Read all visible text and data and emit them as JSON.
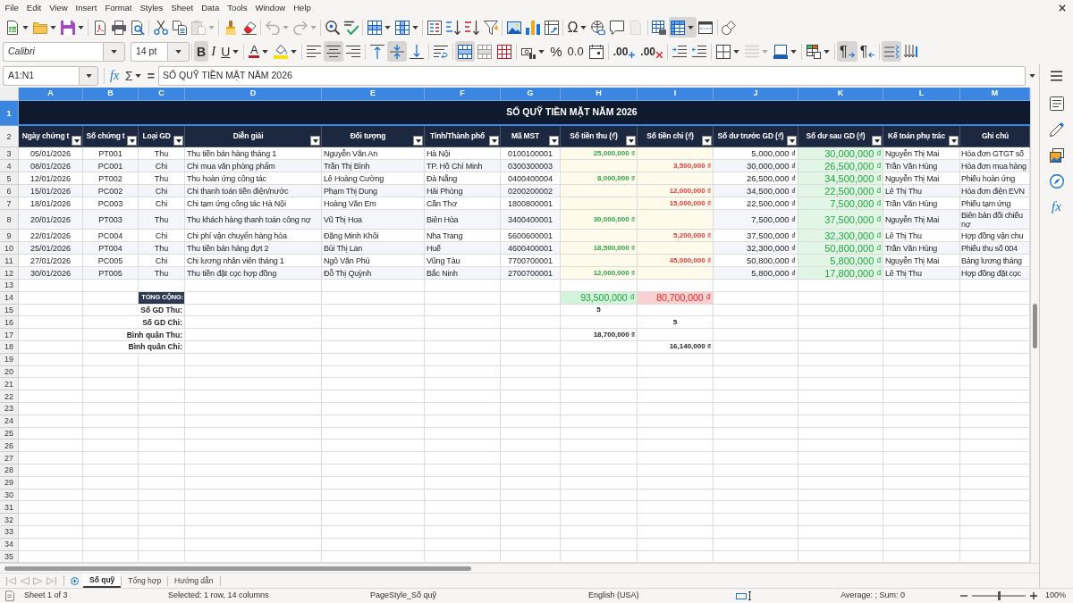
{
  "menu": [
    "File",
    "Edit",
    "View",
    "Insert",
    "Format",
    "Styles",
    "Sheet",
    "Data",
    "Tools",
    "Window",
    "Help"
  ],
  "standard_toolbar": [
    [
      {
        "kind": "new",
        "dropdown": true,
        "on": false,
        "disabled": false
      },
      {
        "kind": "open",
        "dropdown": true,
        "on": false,
        "disabled": false
      },
      {
        "kind": "save",
        "dropdown": true,
        "on": false,
        "disabled": false
      }
    ],
    [
      {
        "kind": "pdf",
        "dropdown": false,
        "on": false,
        "disabled": false
      },
      {
        "kind": "print",
        "dropdown": false,
        "on": false,
        "disabled": false
      },
      {
        "kind": "preview",
        "dropdown": false,
        "on": false,
        "disabled": false
      }
    ],
    [
      {
        "kind": "cut",
        "dropdown": false,
        "on": false,
        "disabled": false
      },
      {
        "kind": "copy",
        "dropdown": false,
        "on": false,
        "disabled": false
      },
      {
        "kind": "paste",
        "dropdown": true,
        "on": false,
        "disabled": true
      }
    ],
    [
      {
        "kind": "clone",
        "dropdown": false,
        "on": false,
        "disabled": false
      },
      {
        "kind": "clear",
        "dropdown": false,
        "on": false,
        "disabled": false
      }
    ],
    [
      {
        "kind": "undo",
        "dropdown": true,
        "on": false,
        "disabled": true
      },
      {
        "kind": "redo",
        "dropdown": true,
        "on": false,
        "disabled": true
      }
    ],
    [
      {
        "kind": "find",
        "dropdown": false,
        "on": false,
        "disabled": false
      },
      {
        "kind": "spelling",
        "dropdown": false,
        "on": false,
        "disabled": false
      }
    ],
    [
      {
        "kind": "rows",
        "dropdown": true,
        "on": false,
        "disabled": false
      },
      {
        "kind": "columns",
        "dropdown": true,
        "on": false,
        "disabled": false
      }
    ],
    [
      {
        "kind": "sort",
        "dropdown": false,
        "on": false,
        "disabled": false
      },
      {
        "kind": "sort_ascending",
        "dropdown": false,
        "on": false,
        "disabled": false
      },
      {
        "kind": "sort_descending",
        "dropdown": false,
        "on": false,
        "disabled": false
      },
      {
        "kind": "autofilter",
        "dropdown": false,
        "on": false,
        "disabled": false
      }
    ],
    [
      {
        "kind": "image",
        "dropdown": false,
        "on": false,
        "disabled": false
      },
      {
        "kind": "chart",
        "dropdown": false,
        "on": false,
        "disabled": false
      },
      {
        "kind": "pivot",
        "dropdown": false,
        "on": false,
        "disabled": false
      }
    ],
    [
      {
        "kind": "special_character",
        "glyph": "Ω",
        "dropdown": true,
        "on": false,
        "disabled": false
      },
      {
        "kind": "hyperlink",
        "dropdown": false,
        "on": false,
        "disabled": false
      },
      {
        "kind": "comment",
        "dropdown": false,
        "on": false,
        "disabled": false
      },
      {
        "kind": "header_footer",
        "dropdown": false,
        "on": false,
        "disabled": true
      }
    ],
    [
      {
        "kind": "print_range",
        "dropdown": false,
        "on": false,
        "disabled": false
      },
      {
        "kind": "freeze",
        "dropdown": true,
        "on": true,
        "disabled": false
      },
      {
        "kind": "split",
        "dropdown": false,
        "on": false,
        "disabled": false
      }
    ],
    [
      {
        "kind": "draw",
        "dropdown": false,
        "on": false,
        "disabled": false
      }
    ]
  ],
  "formatting_toolbar": {
    "font_name": "Calibri",
    "font_size": "14 pt",
    "groups": [
      [
        {
          "kind": "bold",
          "glyph": "B",
          "dropdown": false,
          "on": true,
          "disabled": false
        },
        {
          "kind": "italic",
          "glyph": "I",
          "dropdown": false,
          "on": false,
          "disabled": false
        },
        {
          "kind": "underline",
          "glyph": "U",
          "dropdown": true,
          "on": false,
          "disabled": false
        }
      ],
      [
        {
          "kind": "font_color",
          "glyph": "A",
          "dropdown": true,
          "on": false,
          "disabled": false
        },
        {
          "kind": "highlight",
          "dropdown": true,
          "on": false,
          "disabled": false
        }
      ],
      [
        {
          "kind": "align_left",
          "dropdown": false,
          "on": false,
          "disabled": false
        },
        {
          "kind": "align_center",
          "dropdown": false,
          "on": true,
          "disabled": false
        },
        {
          "kind": "align_right",
          "dropdown": false,
          "on": false,
          "disabled": false
        }
      ],
      [
        {
          "kind": "align_top",
          "dropdown": false,
          "on": false,
          "disabled": false
        },
        {
          "kind": "align_middle",
          "dropdown": false,
          "on": true,
          "disabled": false
        },
        {
          "kind": "align_bottom",
          "dropdown": false,
          "on": false,
          "disabled": false
        }
      ],
      [
        {
          "kind": "wrap",
          "dropdown": false,
          "on": false,
          "disabled": false
        }
      ],
      [
        {
          "kind": "merge_center",
          "dropdown": false,
          "on": true,
          "disabled": false
        },
        {
          "kind": "merge",
          "dropdown": false,
          "on": false,
          "disabled": false
        },
        {
          "kind": "unmerge",
          "dropdown": false,
          "on": false,
          "disabled": false
        }
      ],
      [
        {
          "kind": "currency",
          "dropdown": true,
          "on": false,
          "disabled": false
        },
        {
          "kind": "percent",
          "glyph": "%",
          "dropdown": false,
          "on": false,
          "disabled": false
        },
        {
          "kind": "decimal",
          "glyph": "0.0",
          "dropdown": false,
          "on": false,
          "disabled": false
        },
        {
          "kind": "date",
          "dropdown": false,
          "on": false,
          "disabled": false
        }
      ],
      [
        {
          "kind": "add_decimal",
          "glyph": ".00",
          "dropdown": false,
          "on": false,
          "disabled": false
        },
        {
          "kind": "delete_decimal",
          "glyph": ".00",
          "dropdown": false,
          "on": false,
          "disabled": false
        }
      ],
      [
        {
          "kind": "indent",
          "dropdown": false,
          "on": false,
          "disabled": false
        },
        {
          "kind": "outdent",
          "dropdown": false,
          "on": false,
          "disabled": false
        }
      ],
      [
        {
          "kind": "borders",
          "dropdown": true,
          "on": false,
          "disabled": false
        },
        {
          "kind": "border_style",
          "dropdown": true,
          "on": false,
          "disabled": true
        },
        {
          "kind": "border_color",
          "dropdown": true,
          "on": false,
          "disabled": false
        }
      ],
      [
        {
          "kind": "conditional",
          "dropdown": true,
          "on": false,
          "disabled": false
        }
      ],
      [
        {
          "kind": "ltr",
          "glyph": "¶",
          "dropdown": false,
          "on": true,
          "disabled": false
        },
        {
          "kind": "rtl",
          "glyph": "¶",
          "dropdown": false,
          "on": false,
          "disabled": false
        }
      ],
      [
        {
          "kind": "text_horizontal",
          "dropdown": false,
          "on": true,
          "disabled": false
        },
        {
          "kind": "text_vertical",
          "dropdown": false,
          "on": false,
          "disabled": false
        }
      ]
    ]
  },
  "formula_bar": {
    "name_box": "A1:N1",
    "function_wizard": "fx",
    "sum": "Σ",
    "equals": "=",
    "content": "SỐ QUỸ TIỀN MẶT NĂM 2026"
  },
  "sidebar": [
    {
      "kind": "properties"
    },
    {
      "kind": "styles"
    },
    {
      "kind": "gallery"
    },
    {
      "kind": "navigator"
    },
    {
      "kind": "functions",
      "glyph": "fx"
    }
  ],
  "sheet": {
    "columns": [
      {
        "letter": "A",
        "selected": true,
        "kind": "date"
      },
      {
        "letter": "B",
        "selected": true,
        "kind": "code"
      },
      {
        "letter": "C",
        "selected": true,
        "kind": "type"
      },
      {
        "letter": "D",
        "selected": true,
        "kind": "text"
      },
      {
        "letter": "E",
        "selected": true,
        "kind": "text"
      },
      {
        "letter": "F",
        "selected": true,
        "kind": "text"
      },
      {
        "letter": "G",
        "selected": true,
        "kind": "taxid"
      },
      {
        "letter": "H",
        "selected": true,
        "kind": "income"
      },
      {
        "letter": "I",
        "selected": true,
        "kind": "expense"
      },
      {
        "letter": "J",
        "selected": true,
        "kind": "balance"
      },
      {
        "letter": "K",
        "selected": true,
        "kind": "closing"
      },
      {
        "letter": "L",
        "selected": true,
        "kind": "text"
      },
      {
        "letter": "M",
        "selected": true,
        "kind": "note"
      }
    ],
    "rows": [
      {
        "kind": "title",
        "number": "1",
        "selected": true,
        "title": "SỐ QUỸ TIỀN MẶT NĂM 2026"
      },
      {
        "kind": "header",
        "number": "2",
        "selected": false,
        "cells": [
          {
            "text": "Ngày chứng t",
            "filter": true
          },
          {
            "text": "Số chứng t",
            "filter": true
          },
          {
            "text": "Loại GD",
            "filter": true
          },
          {
            "text": "Diễn giải",
            "filter": true
          },
          {
            "text": "Đối tượng",
            "filter": true
          },
          {
            "text": "Tỉnh/Thành phố",
            "filter": true
          },
          {
            "text": "Mã MST",
            "filter": true
          },
          {
            "text": "Số tiền thu (₫)",
            "filter": true
          },
          {
            "text": "Số tiền chi (₫)",
            "filter": true
          },
          {
            "text": "Số dư trước GD (₫)",
            "filter": true
          },
          {
            "text": "Số dư sau GD (₫)",
            "filter": true
          },
          {
            "text": "Kế toán phụ trác",
            "filter": true
          },
          {
            "text": "Ghi chú",
            "filter": false
          }
        ]
      },
      {
        "kind": "data",
        "number": "3",
        "selected": false,
        "cells": [
          "05/01/2026",
          "PT001",
          "Thu",
          "Thu tiền bán hàng tháng 1",
          "Nguyễn Văn An",
          "Hà Nội",
          "0100100001",
          "25,000,000 ₫",
          null,
          "5,000,000 ₫",
          "30,000,000 ₫",
          "Nguyễn Thị Mai",
          "Hóa đơn GTGT số"
        ]
      },
      {
        "kind": "data",
        "number": "4",
        "selected": false,
        "cells": [
          "08/01/2026",
          "PC001",
          "Chi",
          "Chi mua văn phòng phẩm",
          "Trần Thị Bình",
          "TP. Hồ Chí Minh",
          "0300300003",
          null,
          "3,500,000 ₫",
          "30,000,000 ₫",
          "26,500,000 ₫",
          "Trần Văn Hùng",
          "Hóa đơn mua hàng"
        ]
      },
      {
        "kind": "data",
        "number": "5",
        "selected": false,
        "cells": [
          "12/01/2026",
          "PT002",
          "Thu",
          "Thu hoàn ứng công tác",
          "Lê Hoàng Cường",
          "Đà Nẵng",
          "0400400004",
          "8,000,000 ₫",
          null,
          "26,500,000 ₫",
          "34,500,000 ₫",
          "Nguyễn Thị Mai",
          "Phiếu hoàn ứng"
        ]
      },
      {
        "kind": "data",
        "number": "6",
        "selected": false,
        "cells": [
          "15/01/2026",
          "PC002",
          "Chi",
          "Chi thanh toán tiền điện/nước",
          "Phạm Thị Dung",
          "Hải Phòng",
          "0200200002",
          null,
          "12,000,000 ₫",
          "34,500,000 ₫",
          "22,500,000 ₫",
          "Lê Thị Thu",
          "Hóa đơn điện EVN"
        ]
      },
      {
        "kind": "data",
        "number": "7",
        "selected": false,
        "cells": [
          "18/01/2026",
          "PC003",
          "Chi",
          "Chi tạm ứng công tác Hà Nội",
          "Hoàng Văn Em",
          "Cần Thơ",
          "1800800001",
          null,
          "15,000,000 ₫",
          "22,500,000 ₫",
          "7,500,000 ₫",
          "Trần Văn Hùng",
          "Phiếu tạm ứng"
        ]
      },
      {
        "kind": "data",
        "number": "8",
        "selected": false,
        "cells": [
          "20/01/2026",
          "PT003",
          "Thu",
          "Thu khách hàng thanh toán công nợ",
          "Vũ Thị Hoa",
          "Biên Hòa",
          "3400400001",
          "30,000,000 ₫",
          null,
          "7,500,000 ₫",
          "37,500,000 ₫",
          "Nguyễn Thị Mai",
          "Biên bản đối chiếu nợ"
        ]
      },
      {
        "kind": "data",
        "number": "9",
        "selected": false,
        "cells": [
          "22/01/2026",
          "PC004",
          "Chi",
          "Chi phí vận chuyển hàng hóa",
          "Đặng Minh Khôi",
          "Nha Trang",
          "5600600001",
          null,
          "5,200,000 ₫",
          "37,500,000 ₫",
          "32,300,000 ₫",
          "Lê Thị Thu",
          "Hợp đồng vận chu"
        ]
      },
      {
        "kind": "data",
        "number": "10",
        "selected": false,
        "cells": [
          "25/01/2026",
          "PT004",
          "Thu",
          "Thu tiền bán hàng đợt 2",
          "Bùi Thị Lan",
          "Huế",
          "4600400001",
          "18,500,000 ₫",
          null,
          "32,300,000 ₫",
          "50,800,000 ₫",
          "Trần Văn Hùng",
          "Phiếu thu số 004"
        ]
      },
      {
        "kind": "data",
        "number": "11",
        "selected": false,
        "cells": [
          "27/01/2026",
          "PC005",
          "Chi",
          "Chi lương nhân viên tháng 1",
          "Ngô Văn Phú",
          "Vũng Tàu",
          "7700700001",
          null,
          "45,000,000 ₫",
          "50,800,000 ₫",
          "5,800,000 ₫",
          "Nguyễn Thị Mai",
          "Bảng lương tháng"
        ]
      },
      {
        "kind": "data",
        "number": "12",
        "selected": false,
        "cells": [
          "30/01/2026",
          "PT005",
          "Thu",
          "Thu tiền đặt cọc hợp đồng",
          "Đỗ Thị Quỳnh",
          "Bắc Ninh",
          "2700700001",
          "12,000,000 ₫",
          null,
          "5,800,000 ₫",
          "17,800,000 ₫",
          "Lê Thị Thu",
          "Hợp đồng đặt cọc"
        ]
      },
      {
        "kind": "blank",
        "number": "13",
        "selected": false
      },
      {
        "kind": "total",
        "number": "14",
        "selected": false,
        "label": "TỔNG CỘNG:",
        "income": "93,500,000 ₫",
        "expense": "80,700,000 ₫"
      },
      {
        "kind": "count",
        "number": "15",
        "selected": false,
        "label": "Số GD Thu:",
        "income": "5"
      },
      {
        "kind": "count",
        "number": "16",
        "selected": false,
        "label": "Số GD Chi:",
        "expense": "5"
      },
      {
        "kind": "average",
        "number": "17",
        "selected": false,
        "label": "Bình quân Thu:",
        "income": "18,700,000 ₫"
      },
      {
        "kind": "average",
        "number": "18",
        "selected": false,
        "label": "Bình quân Chi:",
        "expense": "16,140,000 ₫"
      },
      {
        "kind": "blank",
        "number": "19",
        "selected": false
      },
      {
        "kind": "blank",
        "number": "20",
        "selected": false
      },
      {
        "kind": "blank",
        "number": "21",
        "selected": false
      },
      {
        "kind": "blank",
        "number": "22",
        "selected": false
      },
      {
        "kind": "blank",
        "number": "23",
        "selected": false
      },
      {
        "kind": "blank",
        "number": "24",
        "selected": false
      },
      {
        "kind": "blank",
        "number": "25",
        "selected": false
      },
      {
        "kind": "blank",
        "number": "26",
        "selected": false
      },
      {
        "kind": "blank",
        "number": "27",
        "selected": false
      },
      {
        "kind": "blank",
        "number": "28",
        "selected": false
      },
      {
        "kind": "blank",
        "number": "29",
        "selected": false
      },
      {
        "kind": "blank",
        "number": "30",
        "selected": false
      },
      {
        "kind": "blank",
        "number": "31",
        "selected": false
      },
      {
        "kind": "blank",
        "number": "32",
        "selected": false
      },
      {
        "kind": "blank",
        "number": "33",
        "selected": false
      },
      {
        "kind": "blank",
        "number": "34",
        "selected": false
      },
      {
        "kind": "blank",
        "number": "35",
        "selected": false
      }
    ]
  },
  "sheet_tabs": [
    {
      "label": "Số quỹ",
      "selected": true
    },
    {
      "label": "Tổng hợp",
      "selected": false
    },
    {
      "label": "Hướng dẫn",
      "selected": false
    }
  ],
  "status_bar": {
    "sheet": "Sheet 1 of 3",
    "selection": "Selected: 1 row, 14 columns",
    "page_style": "PageStyle_Số quỹ",
    "language": "English (USA)",
    "summary": "Average: ; Sum: 0",
    "zoom": {
      "level": 0.5,
      "reading": "100%"
    }
  }
}
